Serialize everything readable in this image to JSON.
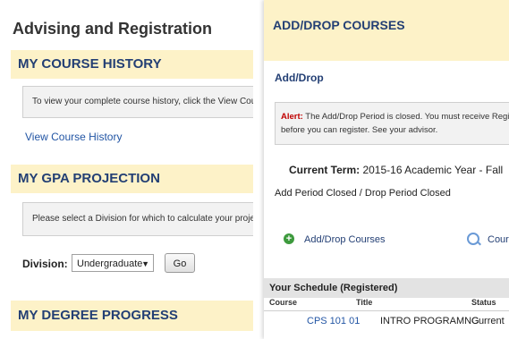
{
  "left": {
    "title": "Advising and Registration",
    "course_history": {
      "header": "MY COURSE HISTORY",
      "info": "To view your complete course history, click the View Course H",
      "link": "View Course History"
    },
    "gpa_projection": {
      "header": "MY GPA PROJECTION",
      "info": "Please select a Division for which to calculate your projected G",
      "division_label": "Division:",
      "division_value": "Undergraduate",
      "go_label": "Go"
    },
    "degree_progress": {
      "header": "MY DEGREE PROGRESS"
    }
  },
  "right": {
    "title": "ADD/DROP COURSES",
    "subtitle": "Add/Drop",
    "alert": {
      "label": "Alert:",
      "line1": " The Add/Drop Period is closed. You must receive Registr",
      "line2": "before you can register. See your advisor."
    },
    "current_term_label": "Current Term:",
    "current_term_value": " 2015-16 Academic Year - Fall",
    "period_status": "Add Period Closed / Drop Period Closed",
    "actions": {
      "add_drop": "Add/Drop Courses",
      "course_search": "Cour"
    },
    "schedule": {
      "header": "Your Schedule (Registered)",
      "columns": [
        "Course",
        "Title",
        "Status"
      ],
      "rows": [
        {
          "course": "CPS 101 01",
          "title": "INTRO PROGRAMNG",
          "status": "Current"
        }
      ]
    }
  }
}
